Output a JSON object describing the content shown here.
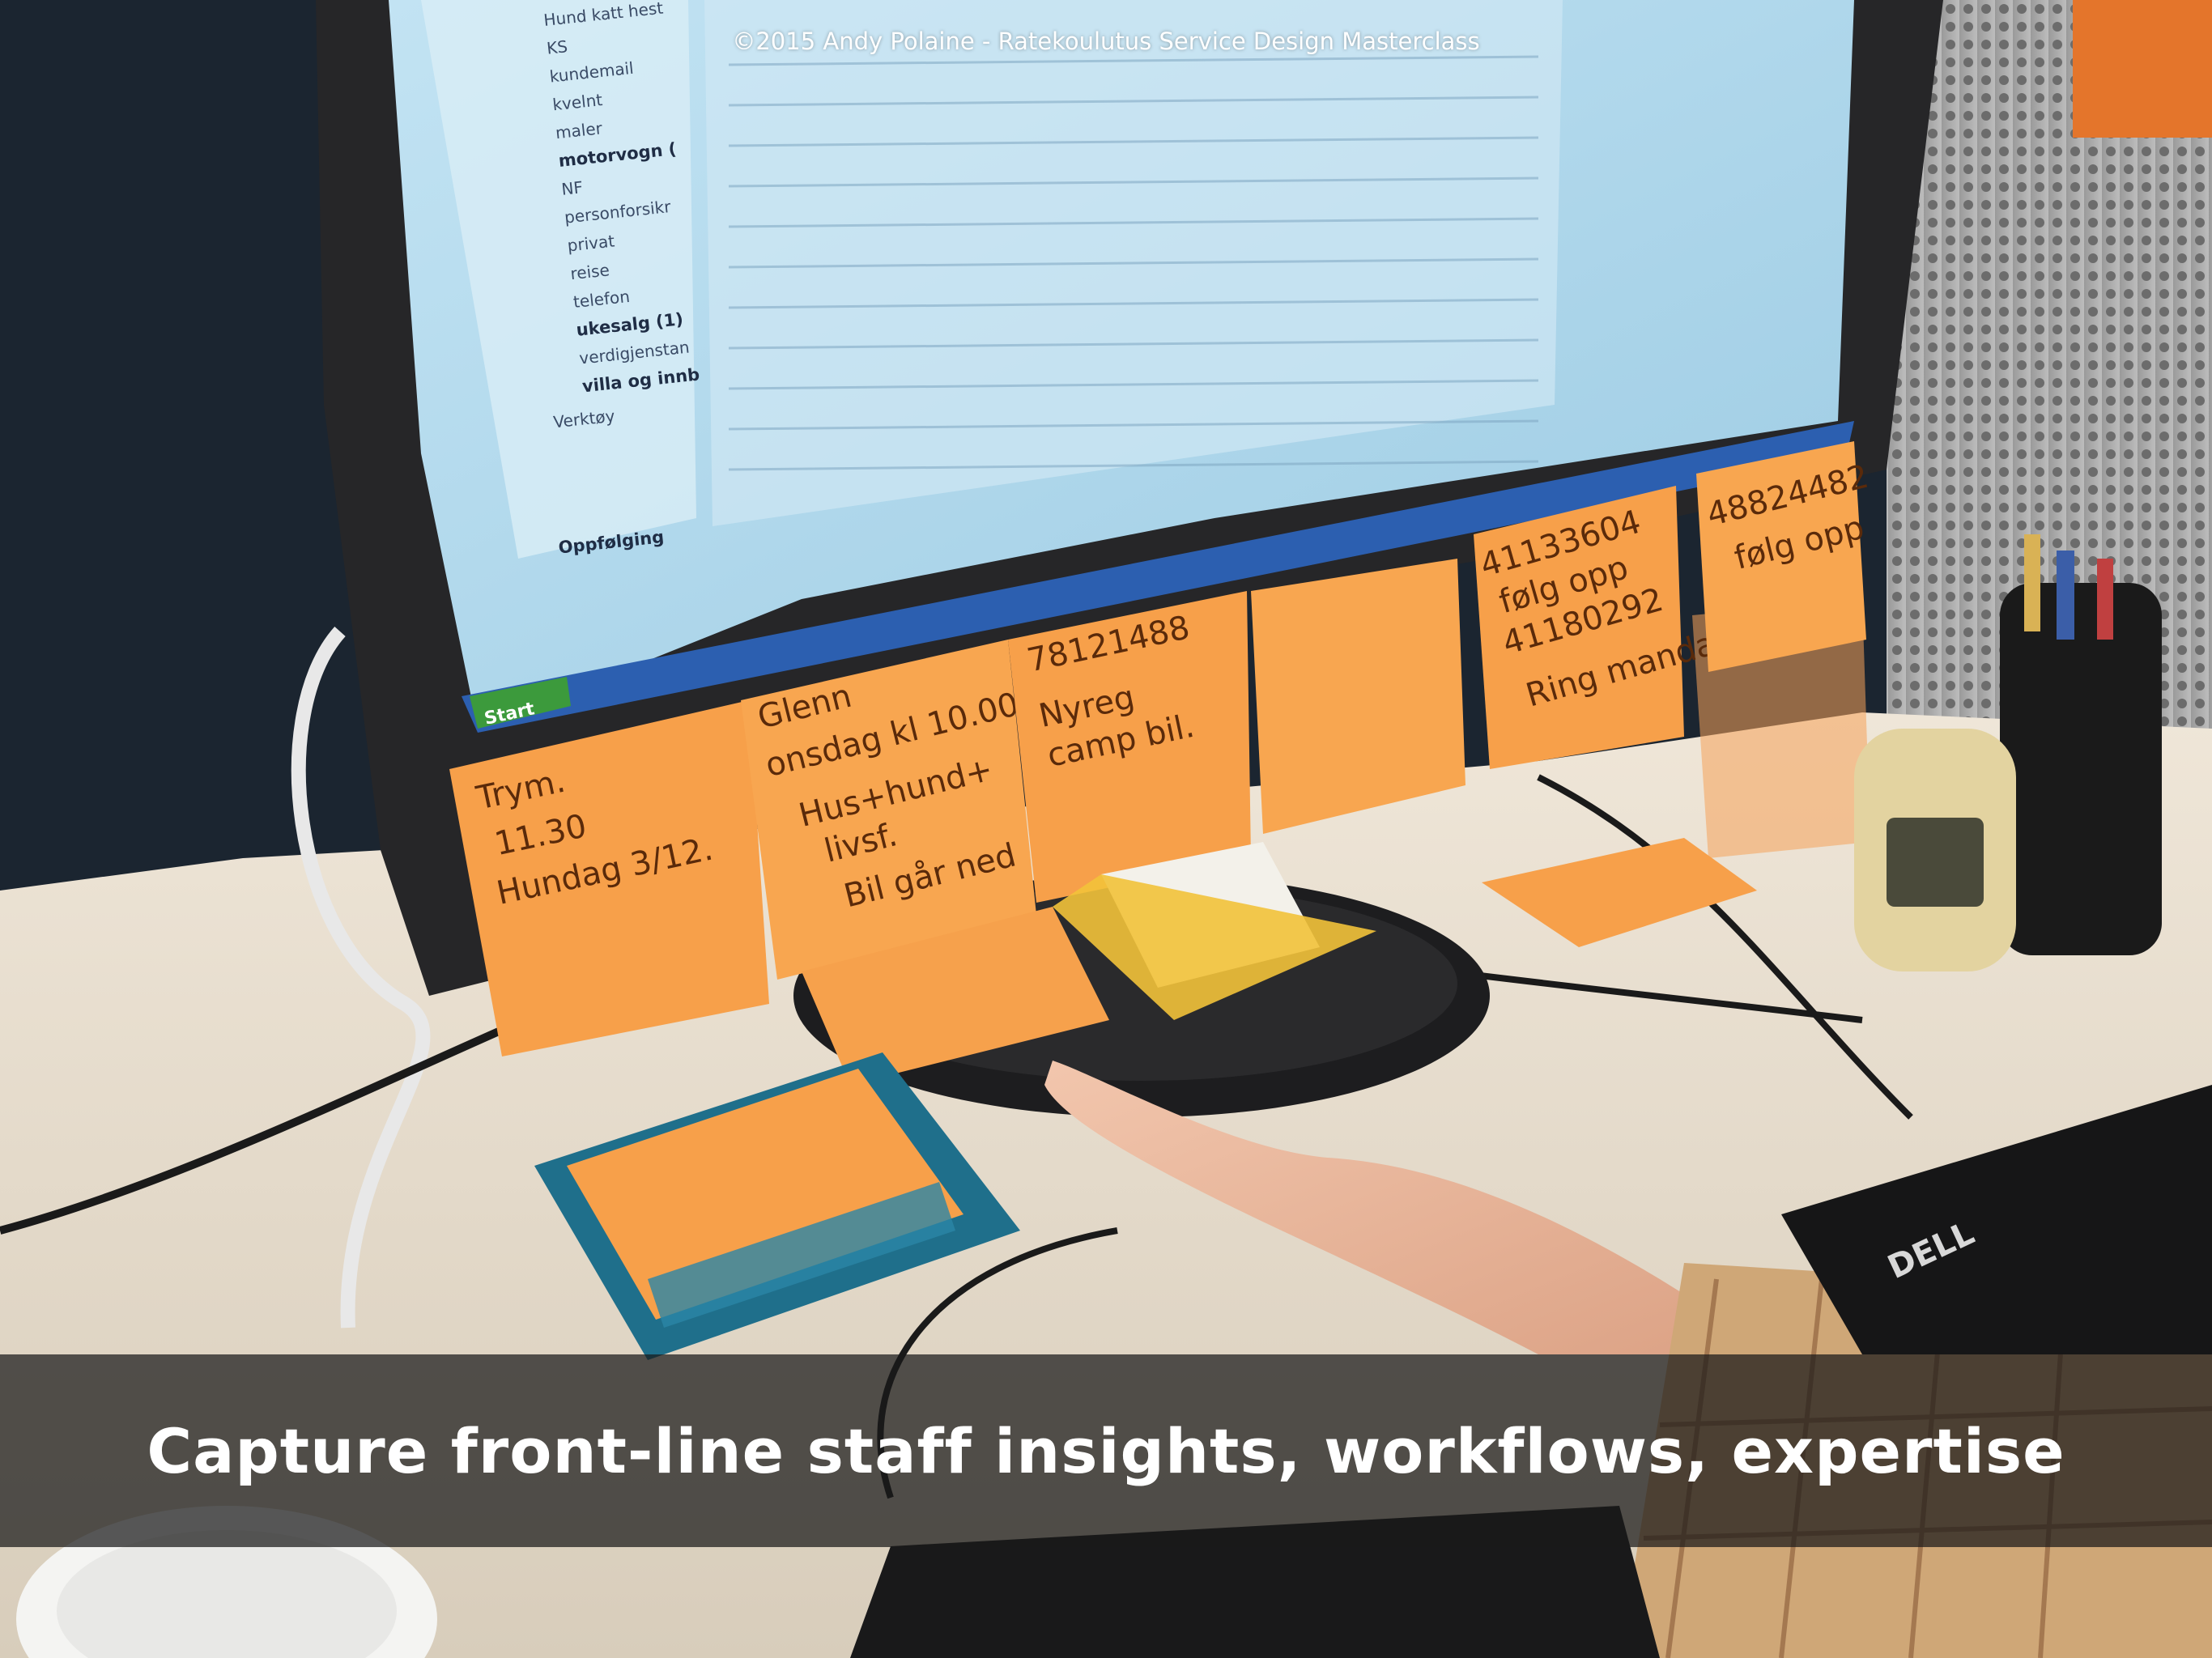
{
  "credit": "©2015 Andy Polaine - Ratekoulutus Service Design Masterclass",
  "caption": "Capture front-line staff insights, workflows, expertise",
  "colors": {
    "desk": "#e6ddcf",
    "wall": "#1c2630",
    "monitor_bezel": "#2a2a2b",
    "screen": "#a8d4ea",
    "sticky_note": "#f7a04a",
    "dispenser": "#1f6f8b",
    "caption_band": "#191919"
  },
  "screen": {
    "folders": [
      "Hund katt hest",
      "KS",
      "kundemail",
      "kvelnt",
      "maler",
      "motorvogn (",
      "NF",
      "personforsikr",
      "privat",
      "reise",
      "telefon",
      "ukesalg (1)",
      "verdigjenstan",
      "villa og innb",
      "Verktøy"
    ],
    "panel_label": "Oppfølging",
    "start_button": "Start"
  },
  "notes": [
    {
      "lines": [
        "Trym.",
        "11.30",
        "Hundag 3/12."
      ]
    },
    {
      "lines": [
        "Glenn",
        "onsdag kl 10.00",
        "Hus+hund+",
        "livsf.",
        "Bil går ned"
      ]
    },
    {
      "lines": [
        "78121488",
        "Nyreg",
        "camp bil."
      ]
    },
    {
      "lines": []
    },
    {
      "lines": [
        "41133604",
        "følg opp",
        "41180292",
        "Ring mandag"
      ]
    },
    {
      "lines": [
        "48824482",
        "følg opp"
      ]
    }
  ],
  "keyboard": {
    "brand": "DELL"
  }
}
